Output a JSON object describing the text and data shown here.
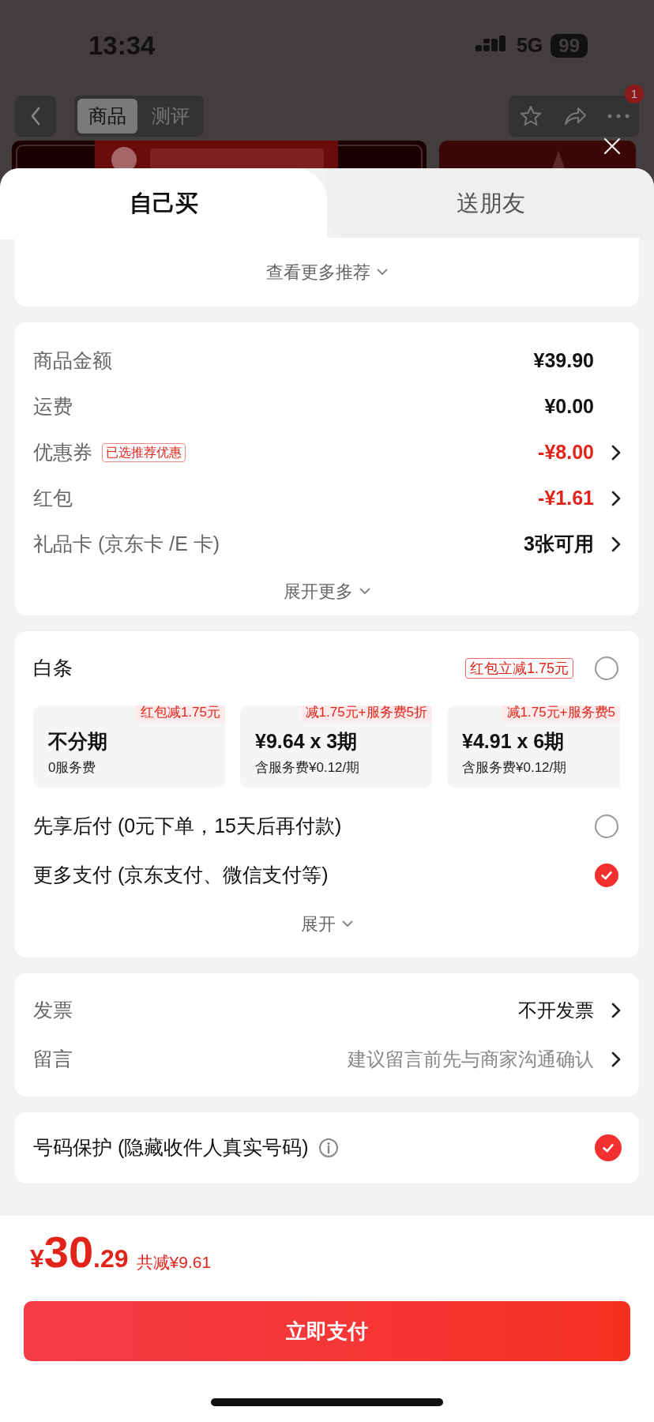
{
  "status_bar": {
    "time": "13:34",
    "network": "5G",
    "battery": "99"
  },
  "nav": {
    "tabs": [
      {
        "label": "商品",
        "selected": true
      },
      {
        "label": "测评",
        "selected": false
      }
    ],
    "badge": "1"
  },
  "sheet_tabs": [
    {
      "label": "自己买",
      "selected": true
    },
    {
      "label": "送朋友",
      "selected": false
    }
  ],
  "recommend_link": "查看更多推荐",
  "price_rows": [
    {
      "label": "商品金额",
      "value": "¥39.90",
      "kind": "amount",
      "arrow": false
    },
    {
      "label": "运费",
      "value": "¥0.00",
      "kind": "amount",
      "arrow": false
    },
    {
      "label": "优惠券",
      "tag": "已选推荐优惠",
      "value": "-¥8.00",
      "kind": "discount",
      "arrow": true
    },
    {
      "label": "红包",
      "value": "-¥1.61",
      "kind": "discount",
      "arrow": true
    },
    {
      "label": "礼品卡 (京东卡 /E 卡)",
      "value": "3张可用",
      "kind": "amount",
      "arrow": true
    }
  ],
  "price_expand": "展开更多",
  "payment": {
    "title": "白条",
    "promo": "红包立减1.75元",
    "selected": false,
    "plans": [
      {
        "badge": "红包减1.75元",
        "title": "不分期",
        "sub": "0服务费"
      },
      {
        "badge": "减1.75元+服务费5折",
        "title": "¥9.64 x 3期",
        "sub": "含服务费¥0.12/期"
      },
      {
        "badge": "减1.75元+服务费5",
        "title": "¥4.91 x 6期",
        "sub": "含服务费¥0.12/期"
      }
    ],
    "options": [
      {
        "label": "先享后付 (0元下单，15天后再付款)",
        "selected": false
      },
      {
        "label": "更多支付 (京东支付、微信支付等)",
        "selected": true
      }
    ],
    "expand": "展开"
  },
  "extra_rows": [
    {
      "label": "发票",
      "kind": "value",
      "value": "不开发票"
    },
    {
      "label": "留言",
      "kind": "hint",
      "value": "建议留言前先与商家沟通确认"
    }
  ],
  "privacy": {
    "label": "号码保护 (隐藏收件人真实号码)",
    "checked": true
  },
  "footer": {
    "currency": "¥",
    "integer": "30",
    "decimal": ".29",
    "saving": "共减¥9.61",
    "button": "立即支付"
  }
}
